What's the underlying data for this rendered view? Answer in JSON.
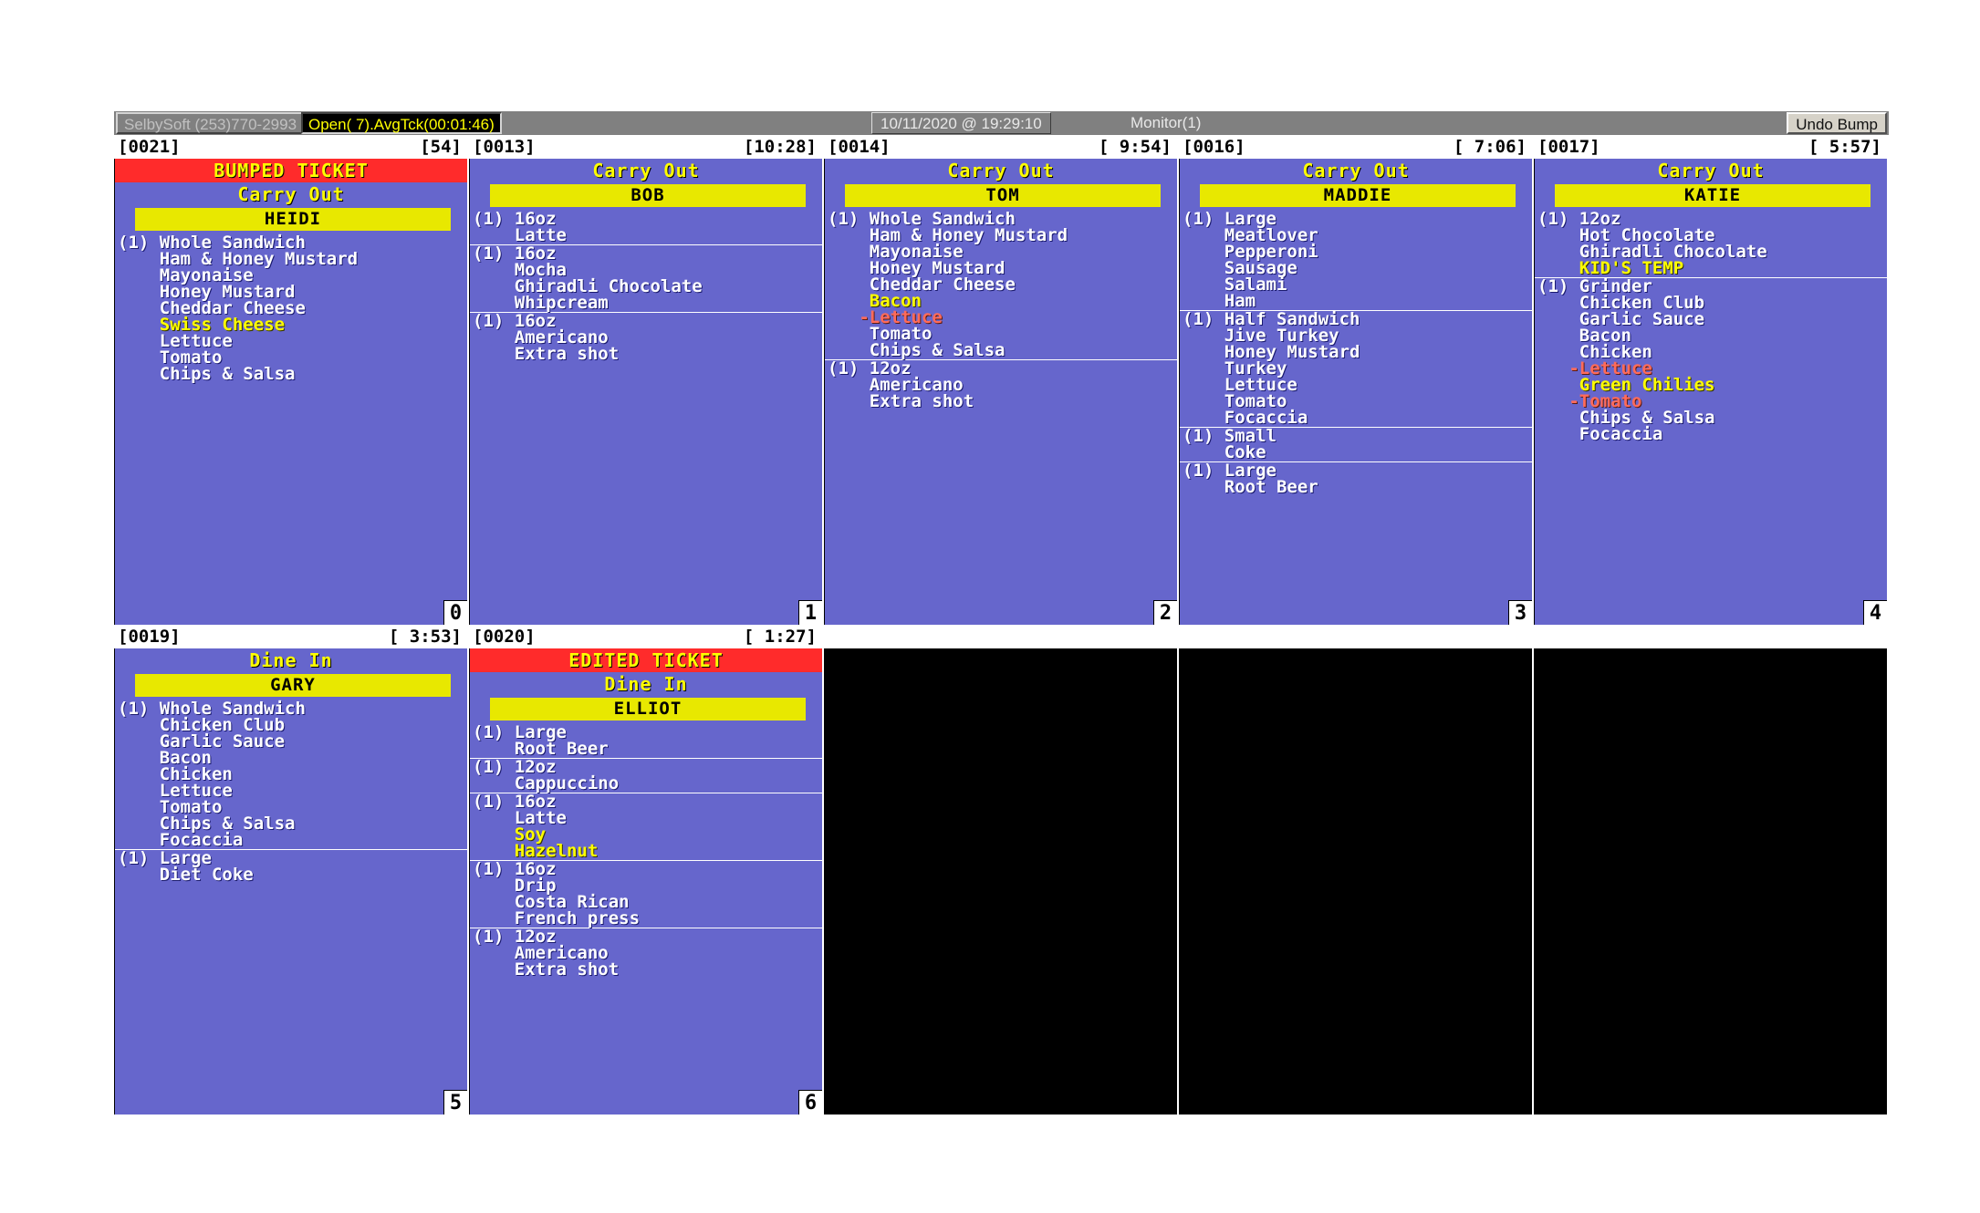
{
  "toolbar": {
    "company": "SelbySoft (253)770-2993",
    "open_stats": "Open( 7).AvgTck(00:01:46)",
    "clock": "10/11/2020 @ 19:29:10",
    "monitor": "Monitor(1)",
    "undo_bump": "Undo Bump"
  },
  "tickets": [
    {
      "number": "[0021]",
      "time": "[54]",
      "badge": "0",
      "banner": "BUMPED TICKET",
      "service_type": "Carry Out",
      "name": "HEIDI",
      "items": [
        {
          "lines": [
            {
              "text": "(1) Whole Sandwich",
              "style": "normal"
            },
            {
              "text": "    Ham & Honey Mustard",
              "style": "normal"
            },
            {
              "text": "    Mayonaise",
              "style": "normal"
            },
            {
              "text": "    Honey Mustard",
              "style": "normal"
            },
            {
              "text": "    Cheddar Cheese",
              "style": "normal"
            },
            {
              "text": "    Swiss Cheese",
              "style": "highlight"
            },
            {
              "text": "    Lettuce",
              "style": "normal"
            },
            {
              "text": "    Tomato",
              "style": "normal"
            },
            {
              "text": "    Chips & Salsa",
              "style": "normal"
            }
          ]
        }
      ]
    },
    {
      "number": "[0013]",
      "time": "[10:28]",
      "badge": "1",
      "banner": "",
      "service_type": "Carry Out",
      "name": "BOB",
      "items": [
        {
          "lines": [
            {
              "text": "(1) 16oz",
              "style": "normal"
            },
            {
              "text": "    Latte",
              "style": "normal"
            }
          ]
        },
        {
          "lines": [
            {
              "text": "(1) 16oz",
              "style": "normal"
            },
            {
              "text": "    Mocha",
              "style": "normal"
            },
            {
              "text": "    Ghiradli Chocolate",
              "style": "normal"
            },
            {
              "text": "    Whipcream",
              "style": "normal"
            }
          ]
        },
        {
          "lines": [
            {
              "text": "(1) 16oz",
              "style": "normal"
            },
            {
              "text": "    Americano",
              "style": "normal"
            },
            {
              "text": "    Extra shot",
              "style": "normal"
            }
          ]
        }
      ]
    },
    {
      "number": "[0014]",
      "time": "[ 9:54]",
      "badge": "2",
      "banner": "",
      "service_type": "Carry Out",
      "name": "TOM",
      "items": [
        {
          "lines": [
            {
              "text": "(1) Whole Sandwich",
              "style": "normal"
            },
            {
              "text": "    Ham & Honey Mustard",
              "style": "normal"
            },
            {
              "text": "    Mayonaise",
              "style": "normal"
            },
            {
              "text": "    Honey Mustard",
              "style": "normal"
            },
            {
              "text": "    Cheddar Cheese",
              "style": "normal"
            },
            {
              "text": "    Bacon",
              "style": "highlight"
            },
            {
              "text": "   -Lettuce",
              "style": "removed"
            },
            {
              "text": "    Tomato",
              "style": "normal"
            },
            {
              "text": "    Chips & Salsa",
              "style": "normal"
            }
          ]
        },
        {
          "lines": [
            {
              "text": "(1) 12oz",
              "style": "normal"
            },
            {
              "text": "    Americano",
              "style": "normal"
            },
            {
              "text": "    Extra shot",
              "style": "normal"
            }
          ]
        }
      ]
    },
    {
      "number": "[0016]",
      "time": "[ 7:06]",
      "badge": "3",
      "banner": "",
      "service_type": "Carry Out",
      "name": "MADDIE",
      "items": [
        {
          "lines": [
            {
              "text": "(1) Large",
              "style": "normal"
            },
            {
              "text": "    Meatlover",
              "style": "normal"
            },
            {
              "text": "    Pepperoni",
              "style": "normal"
            },
            {
              "text": "    Sausage",
              "style": "normal"
            },
            {
              "text": "    Salami",
              "style": "normal"
            },
            {
              "text": "    Ham",
              "style": "normal"
            }
          ]
        },
        {
          "lines": [
            {
              "text": "(1) Half Sandwich",
              "style": "normal"
            },
            {
              "text": "    Jive Turkey",
              "style": "normal"
            },
            {
              "text": "    Honey Mustard",
              "style": "normal"
            },
            {
              "text": "    Turkey",
              "style": "normal"
            },
            {
              "text": "    Lettuce",
              "style": "normal"
            },
            {
              "text": "    Tomato",
              "style": "normal"
            },
            {
              "text": "    Focaccia",
              "style": "normal"
            }
          ]
        },
        {
          "lines": [
            {
              "text": "(1) Small",
              "style": "normal"
            },
            {
              "text": "    Coke",
              "style": "normal"
            }
          ]
        },
        {
          "lines": [
            {
              "text": "(1) Large",
              "style": "normal"
            },
            {
              "text": "    Root Beer",
              "style": "normal"
            }
          ]
        }
      ]
    },
    {
      "number": "[0017]",
      "time": "[ 5:57]",
      "badge": "4",
      "banner": "",
      "service_type": "Carry Out",
      "name": "KATIE",
      "items": [
        {
          "lines": [
            {
              "text": "(1) 12oz",
              "style": "normal"
            },
            {
              "text": "    Hot Chocolate",
              "style": "normal"
            },
            {
              "text": "    Ghiradli Chocolate",
              "style": "normal"
            },
            {
              "text": "    KID'S TEMP",
              "style": "highlight"
            }
          ]
        },
        {
          "lines": [
            {
              "text": "(1) Grinder",
              "style": "normal"
            },
            {
              "text": "    Chicken Club",
              "style": "normal"
            },
            {
              "text": "    Garlic Sauce",
              "style": "normal"
            },
            {
              "text": "    Bacon",
              "style": "normal"
            },
            {
              "text": "    Chicken",
              "style": "normal"
            },
            {
              "text": "   -Lettuce",
              "style": "removed"
            },
            {
              "text": "    Green Chilies",
              "style": "highlight"
            },
            {
              "text": "   -Tomato",
              "style": "removed"
            },
            {
              "text": "    Chips & Salsa",
              "style": "normal"
            },
            {
              "text": "    Focaccia",
              "style": "normal"
            }
          ]
        }
      ]
    },
    {
      "number": "[0019]",
      "time": "[ 3:53]",
      "badge": "5",
      "banner": "",
      "service_type": "Dine In",
      "name": "GARY",
      "items": [
        {
          "lines": [
            {
              "text": "(1) Whole Sandwich",
              "style": "normal"
            },
            {
              "text": "    Chicken Club",
              "style": "normal"
            },
            {
              "text": "    Garlic Sauce",
              "style": "normal"
            },
            {
              "text": "    Bacon",
              "style": "normal"
            },
            {
              "text": "    Chicken",
              "style": "normal"
            },
            {
              "text": "    Lettuce",
              "style": "normal"
            },
            {
              "text": "    Tomato",
              "style": "normal"
            },
            {
              "text": "    Chips & Salsa",
              "style": "normal"
            },
            {
              "text": "    Focaccia",
              "style": "normal"
            }
          ]
        },
        {
          "lines": [
            {
              "text": "(1) Large",
              "style": "normal"
            },
            {
              "text": "    Diet Coke",
              "style": "normal"
            }
          ]
        }
      ]
    },
    {
      "number": "[0020]",
      "time": "[ 1:27]",
      "badge": "6",
      "banner": "EDITED TICKET",
      "service_type": "Dine In",
      "name": "ELLIOT",
      "items": [
        {
          "lines": [
            {
              "text": "(1) Large",
              "style": "normal"
            },
            {
              "text": "    Root Beer",
              "style": "normal"
            }
          ]
        },
        {
          "lines": [
            {
              "text": "(1) 12oz",
              "style": "normal"
            },
            {
              "text": "    Cappuccino",
              "style": "normal"
            }
          ]
        },
        {
          "lines": [
            {
              "text": "(1) 16oz",
              "style": "normal"
            },
            {
              "text": "    Latte",
              "style": "normal"
            },
            {
              "text": "    Soy",
              "style": "highlight"
            },
            {
              "text": "    Hazelnut",
              "style": "highlight"
            }
          ]
        },
        {
          "lines": [
            {
              "text": "(1) 16oz",
              "style": "normal"
            },
            {
              "text": "    Drip",
              "style": "normal"
            },
            {
              "text": "    Costa Rican",
              "style": "normal"
            },
            {
              "text": "    French press",
              "style": "normal"
            }
          ]
        },
        {
          "lines": [
            {
              "text": "(1) 12oz",
              "style": "normal"
            },
            {
              "text": "    Americano",
              "style": "normal"
            },
            {
              "text": "    Extra shot",
              "style": "normal"
            }
          ]
        }
      ]
    },
    {
      "empty": true
    },
    {
      "empty": true
    },
    {
      "empty": true
    }
  ],
  "colors": {
    "ticket_background": "#6666cc",
    "banner_background": "#ff2b2b",
    "banner_text": "#ffff00",
    "name_bar": "#e8e800",
    "highlight_text": "#ffff00",
    "removed_text": "#ff6b5a",
    "toolbar_background": "#808080"
  }
}
